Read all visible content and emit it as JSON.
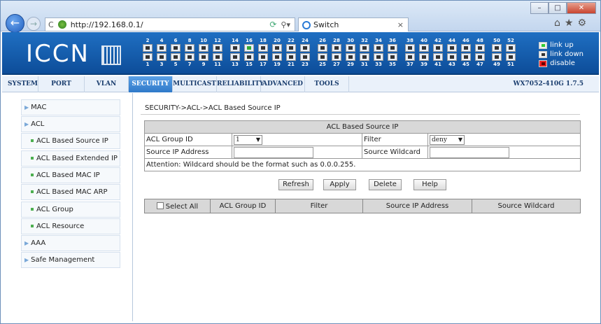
{
  "browser": {
    "url": "http://192.168.0.1/",
    "tab_title": "Switch",
    "window_min": "–",
    "window_max": "□",
    "window_close": "✕",
    "tab_close": "×",
    "toolbar_icons": "⌂★⚙"
  },
  "header": {
    "logo_text": "ICCN",
    "ports_top": [
      "2",
      "4",
      "6",
      "8",
      "10",
      "12",
      "14",
      "16",
      "18",
      "20",
      "22",
      "24",
      "26",
      "28",
      "30",
      "32",
      "34",
      "36",
      "38",
      "40",
      "42",
      "44",
      "46",
      "48",
      "50",
      "52"
    ],
    "ports_bottom": [
      "1",
      "3",
      "5",
      "7",
      "9",
      "11",
      "13",
      "15",
      "17",
      "19",
      "21",
      "23",
      "25",
      "27",
      "29",
      "31",
      "33",
      "35",
      "37",
      "39",
      "41",
      "43",
      "45",
      "47",
      "49",
      "51"
    ],
    "legend": {
      "link_up": "link up",
      "link_down": "link down",
      "disable": "disable"
    }
  },
  "nav": {
    "items": [
      "SYSTEM",
      "PORT",
      "VLAN",
      "SECURITY",
      "MULTICAST",
      "RELIABILITY",
      "ADVANCED",
      "TOOLS"
    ],
    "active": "SECURITY",
    "version": "WX7052-410G 1.7.5"
  },
  "sidebar": {
    "items": [
      {
        "label": "MAC"
      },
      {
        "label": "ACL"
      },
      {
        "label": "ACL Based Source IP"
      },
      {
        "label": "ACL Based Extended IP"
      },
      {
        "label": "ACL Based MAC IP"
      },
      {
        "label": "ACL Based MAC ARP"
      },
      {
        "label": "ACL Group"
      },
      {
        "label": "ACL Resource"
      },
      {
        "label": "AAA"
      },
      {
        "label": "Safe Management"
      }
    ]
  },
  "main": {
    "breadcrumb": "SECURITY->ACL->ACL Based Source IP",
    "form": {
      "caption": "ACL Based Source IP",
      "group_label": "ACL Group ID",
      "group_value": "1",
      "filter_label": "Filter",
      "filter_value": "deny",
      "source_ip_label": "Source IP Address",
      "source_ip_value": "",
      "wildcard_label": "Source Wildcard",
      "wildcard_value": "",
      "attention": "Attention: Wildcard should be the format such as 0.0.0.255."
    },
    "buttons": {
      "refresh": "Refresh",
      "apply": "Apply",
      "delete": "Delete",
      "help": "Help"
    },
    "list_headers": {
      "select_all": "Select All",
      "group": "ACL Group ID",
      "filter": "Filter",
      "source_ip": "Source IP Address",
      "wildcard": "Source Wildcard"
    }
  }
}
